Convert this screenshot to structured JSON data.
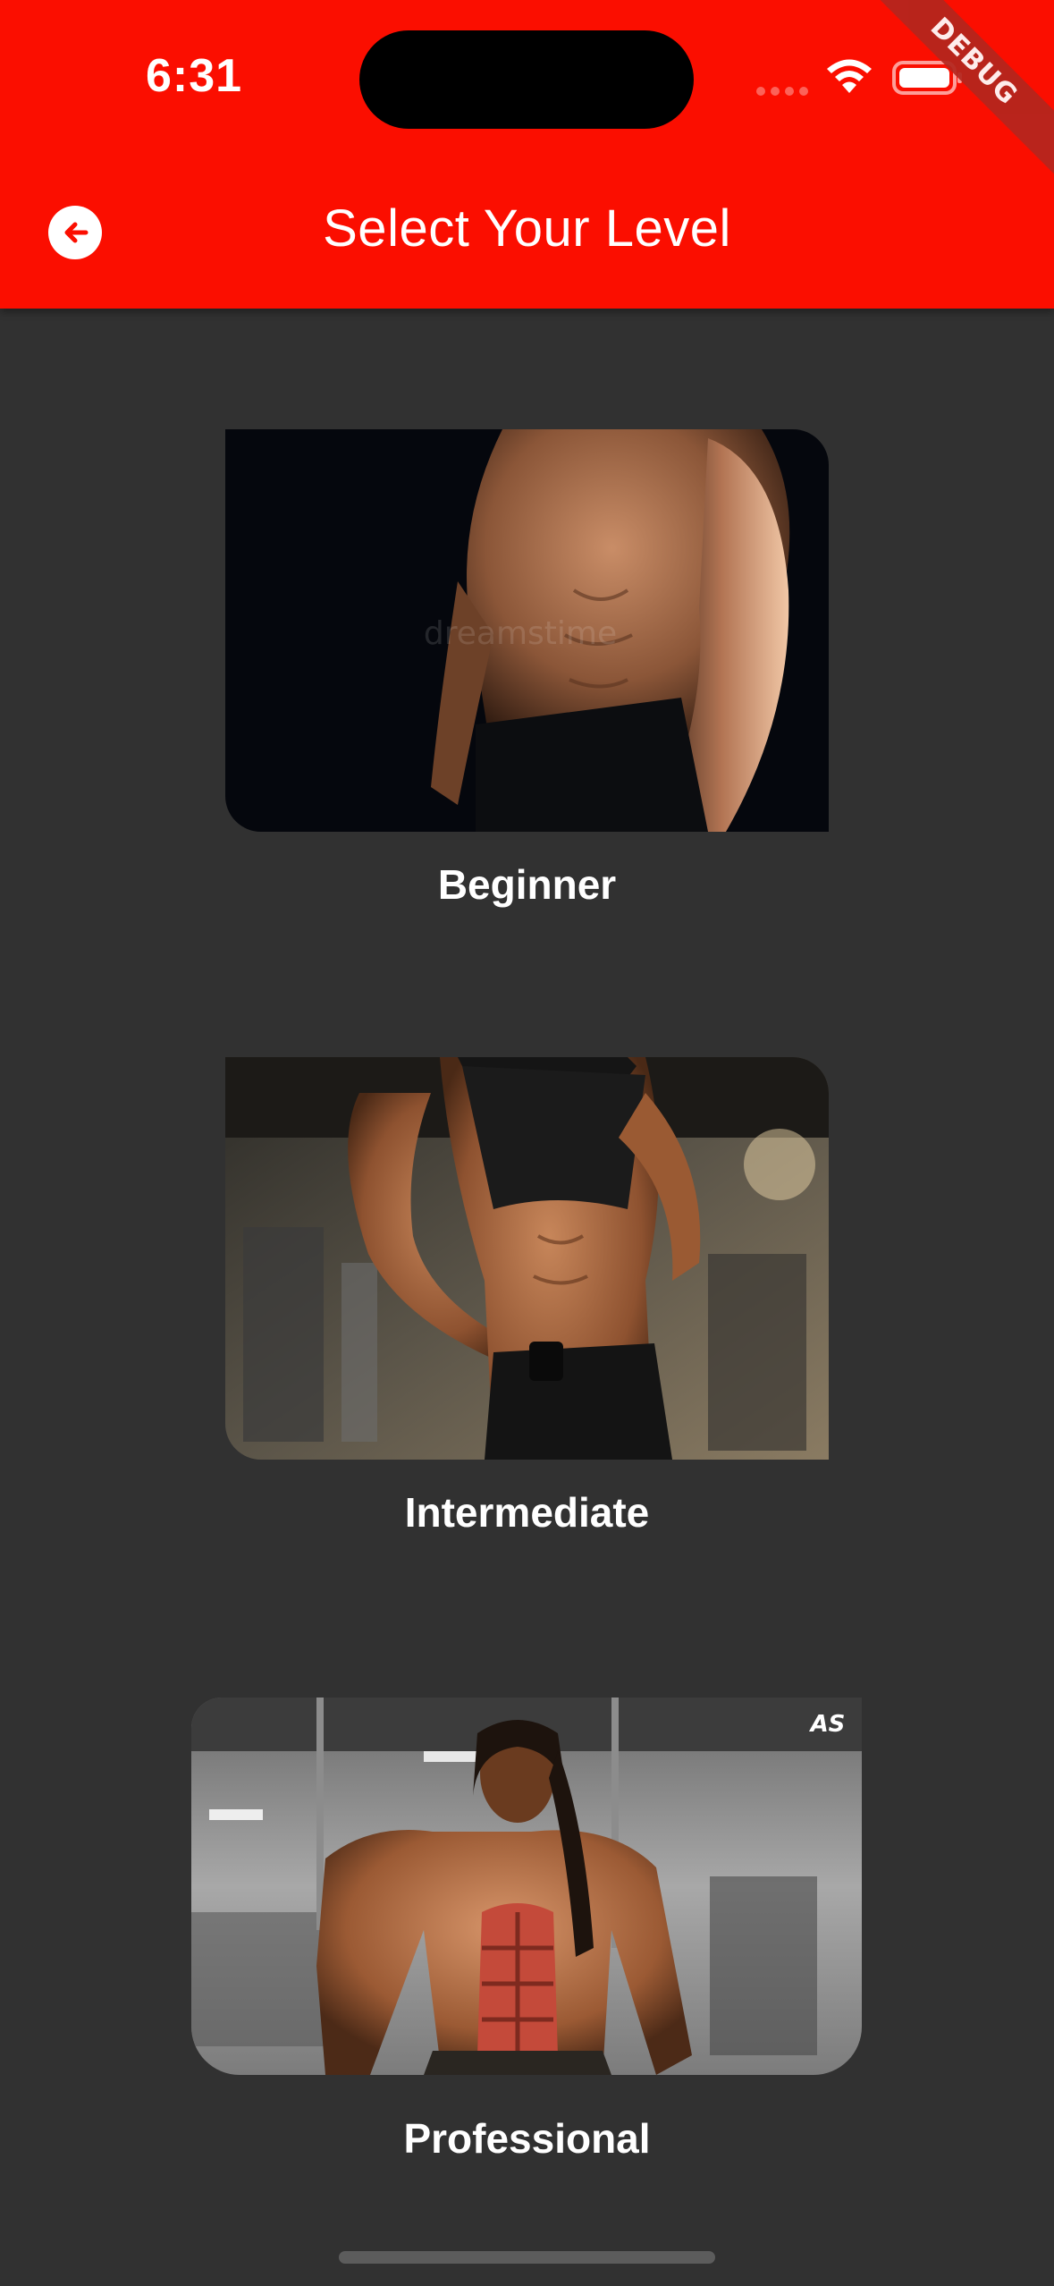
{
  "status_bar": {
    "time": "6:31",
    "debug_label": "DEBUG"
  },
  "header": {
    "title": "Select Your Level",
    "back_icon": "arrow-left-circle-icon",
    "background_color": "#fb0e00"
  },
  "levels": [
    {
      "label": "Beginner",
      "image": "beginner-torso-photo"
    },
    {
      "label": "Intermediate",
      "image": "intermediate-athlete-photo"
    },
    {
      "label": "Professional",
      "image": "professional-bodybuilder-photo"
    }
  ],
  "colors": {
    "background": "#313131",
    "accent": "#fb0e00",
    "text": "#ffffff"
  }
}
